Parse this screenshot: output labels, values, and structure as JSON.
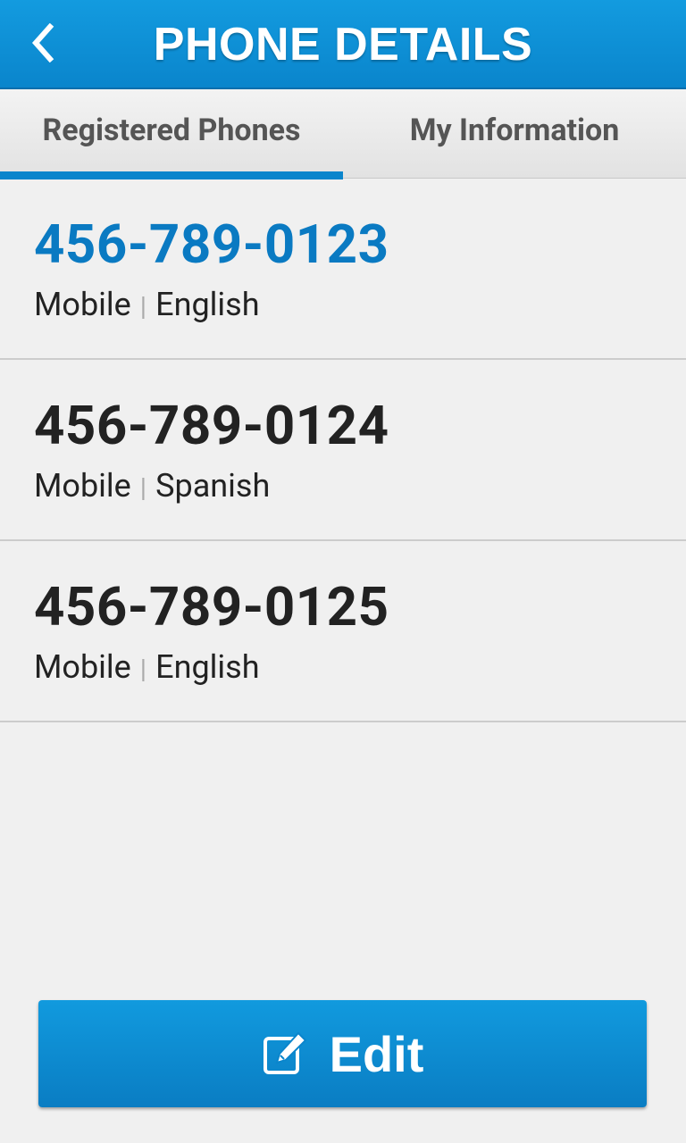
{
  "header": {
    "title": "PHONE DETAILS",
    "back_icon": "chevron-left-icon"
  },
  "tabs": [
    {
      "label": "Registered Phones",
      "active": true
    },
    {
      "label": "My Information",
      "active": false
    }
  ],
  "phones": [
    {
      "number": "456-789-0123",
      "type": "Mobile",
      "separator": "|",
      "language": "English",
      "selected": true
    },
    {
      "number": "456-789-0124",
      "type": "Mobile",
      "separator": "|",
      "language": "Spanish",
      "selected": false
    },
    {
      "number": "456-789-0125",
      "type": "Mobile",
      "separator": "|",
      "language": "English",
      "selected": false
    }
  ],
  "edit_button": {
    "label": "Edit",
    "icon": "edit-pencil-icon"
  },
  "colors": {
    "accent": "#0a85cc",
    "selected_text": "#0a7ac2",
    "background": "#f0f0f0"
  }
}
